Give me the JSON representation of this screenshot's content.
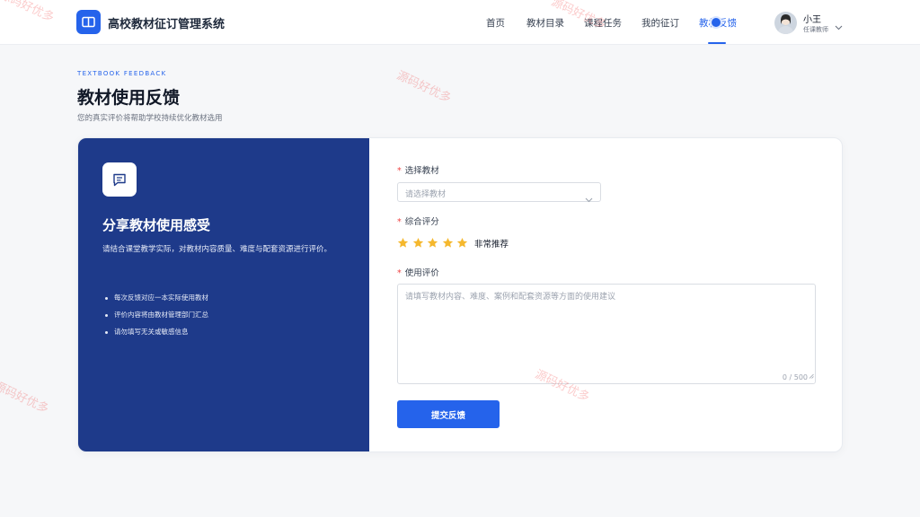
{
  "header": {
    "app_title": "高校教材征订管理系统",
    "nav": [
      "首页",
      "教材目录",
      "课程任务",
      "我的征订",
      "教材反馈"
    ],
    "active_nav": 4,
    "user": {
      "name": "小王",
      "role": "任课教师"
    }
  },
  "page": {
    "eyebrow": "TEXTBOOK FEEDBACK",
    "title": "教材使用反馈",
    "subtitle": "您的真实评价将帮助学校持续优化教材选用"
  },
  "info_panel": {
    "title": "分享教材使用感受",
    "description": "请结合课堂教学实际，对教材内容质量、难度与配套资源进行评价。",
    "bullets": [
      "每次反馈对应一本实际使用教材",
      "评价内容将由教材管理部门汇总",
      "请勿填写无关或敏感信息"
    ]
  },
  "form": {
    "textbook": {
      "label": "选择教材",
      "required_mark": "*",
      "placeholder": "请选择教材"
    },
    "rating": {
      "label": "综合评分",
      "required_mark": "*",
      "value": 5,
      "max": 5,
      "text": "非常推荐"
    },
    "comment": {
      "label": "使用评价",
      "required_mark": "*",
      "placeholder": "请填写教材内容、难度、案例和配套资源等方面的使用建议",
      "counter": "0 / 500"
    },
    "submit_label": "提交反馈"
  },
  "watermark": "源码好优多",
  "colors": {
    "primary": "#2563eb",
    "panel": "#1e3a8a",
    "star": "#f5b82e",
    "required": "#ef4444"
  }
}
